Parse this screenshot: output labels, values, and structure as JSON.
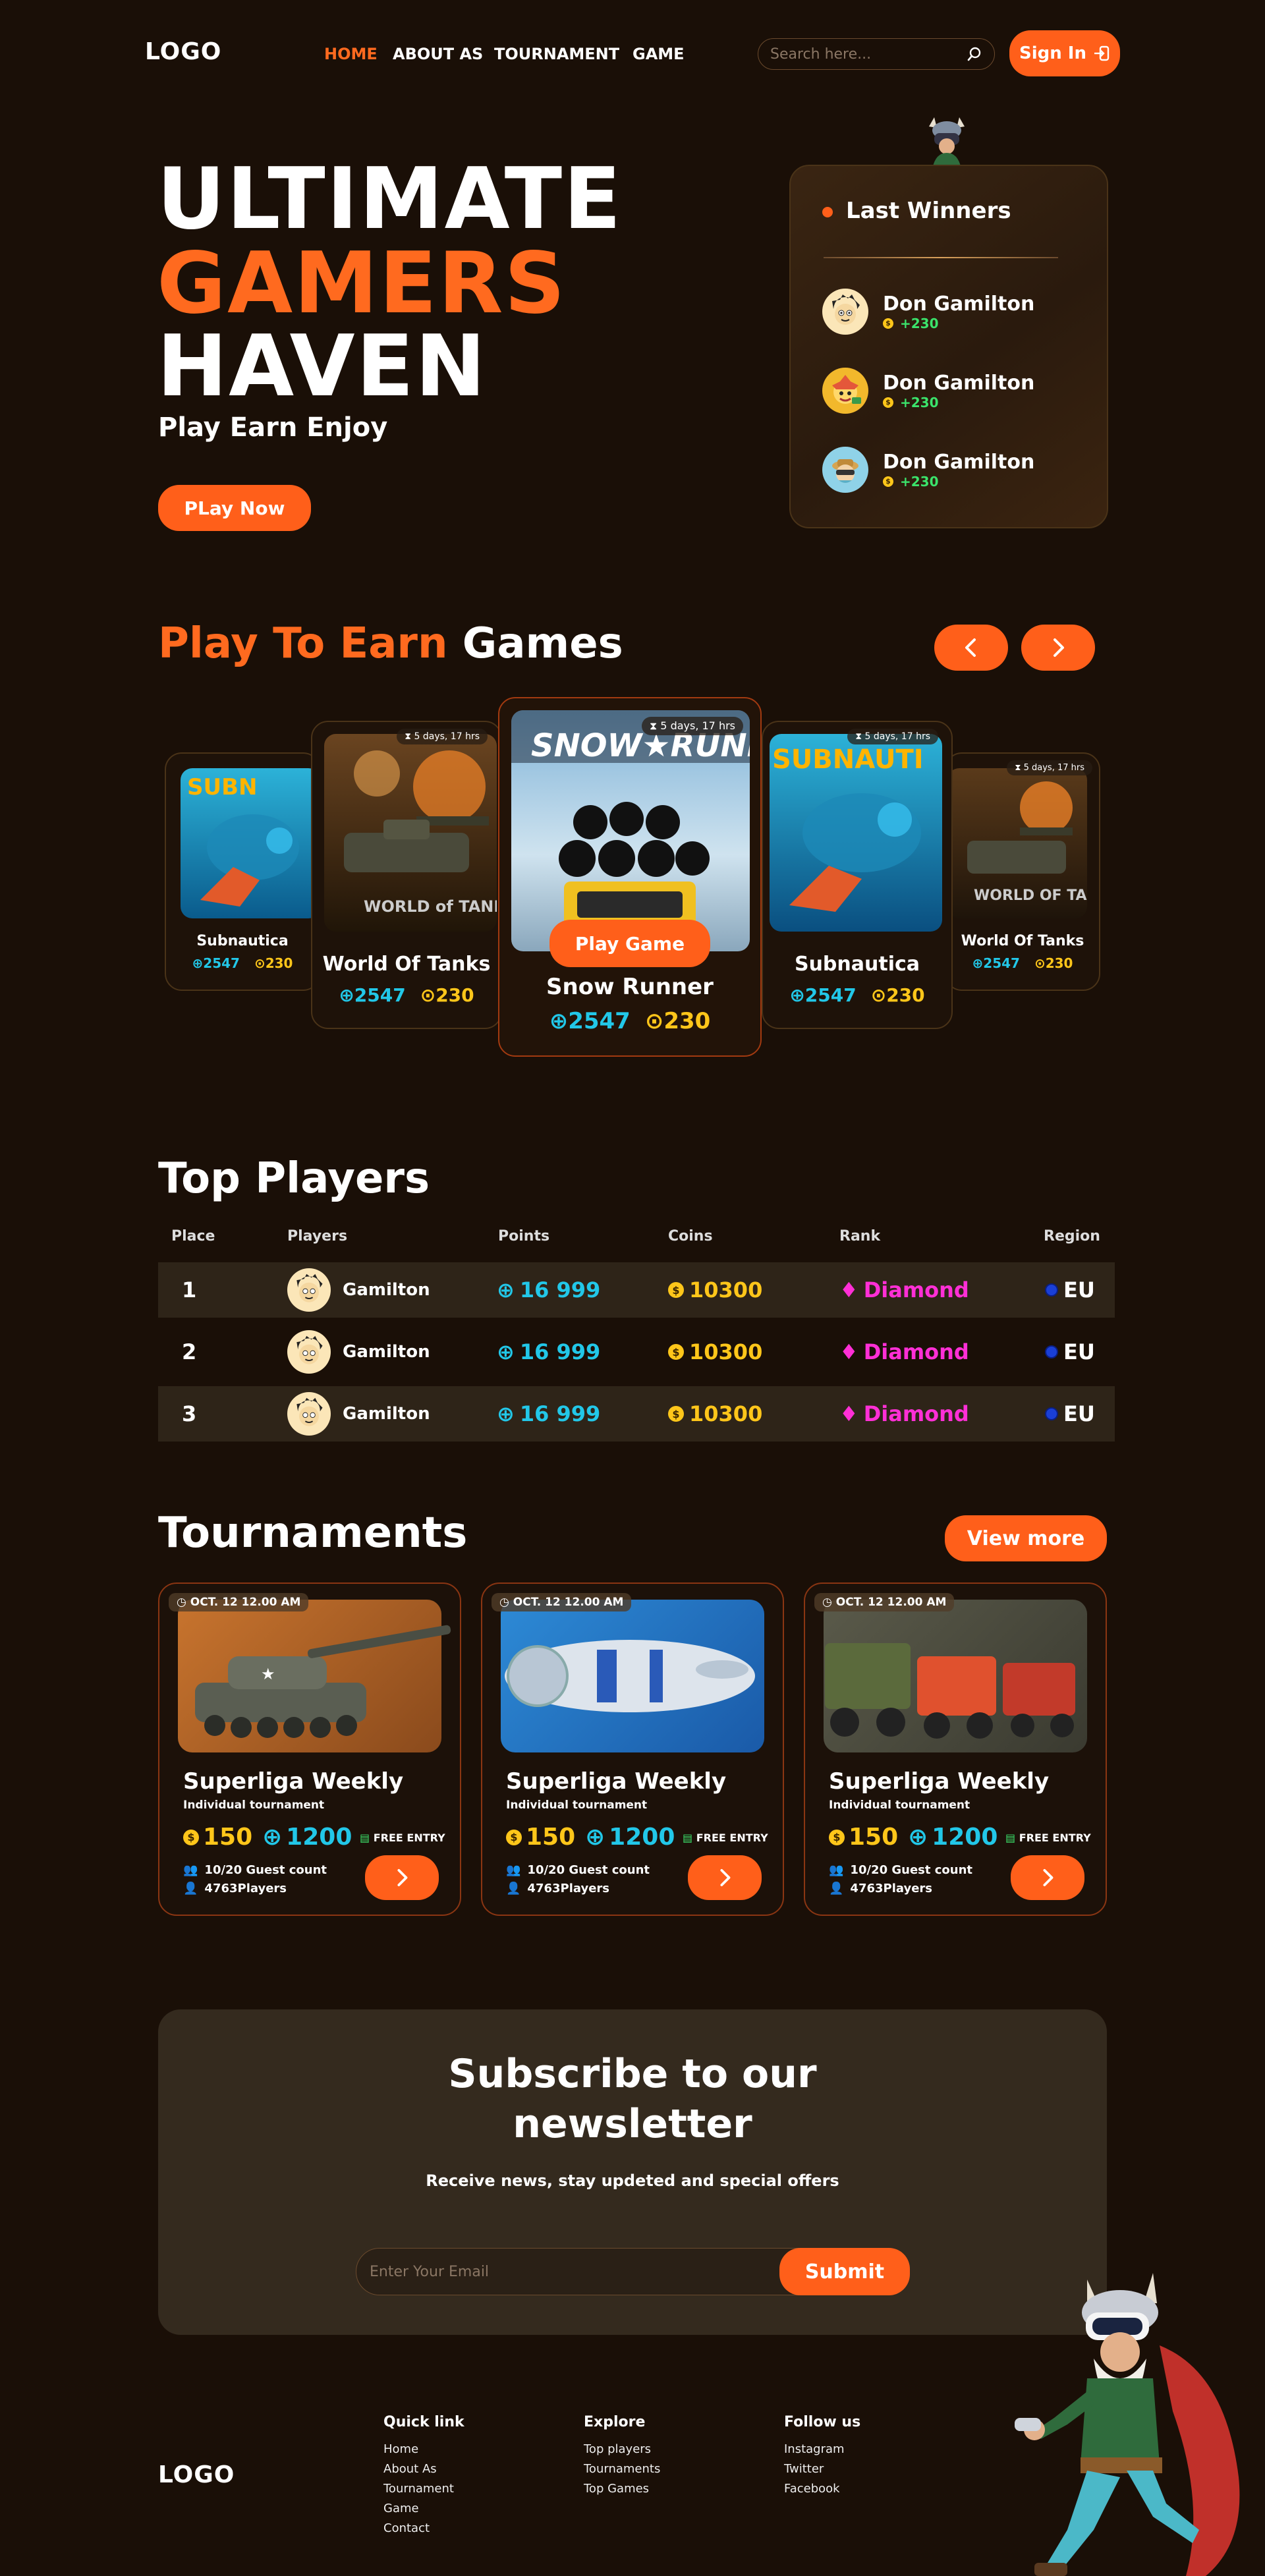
{
  "nav": {
    "logo": "LOGO",
    "links": [
      "HOME",
      "ABOUT AS",
      "TOURNAMENT",
      "GAME"
    ],
    "search_placeholder": "Search here...",
    "signin_label": "Sign In"
  },
  "hero": {
    "line1": "ULTIMATE",
    "line2": "GAMERS",
    "line3": "HAVEN",
    "tagline": "Play Earn Enjoy",
    "cta": "PLay Now"
  },
  "winners": {
    "title": "Last Winners",
    "items": [
      {
        "name": "Don Gamilton",
        "points": "+230"
      },
      {
        "name": "Don Gamilton",
        "points": "+230"
      },
      {
        "name": "Don Gamilton",
        "points": "+230"
      }
    ]
  },
  "games_section": {
    "title_highlight": "Play To Earn",
    "title_rest": "Games",
    "play_label": "Play Game",
    "timer": "5 days, 17 hrs",
    "cards": [
      {
        "title": "Subnautica",
        "points": "2547",
        "coins": "230"
      },
      {
        "title": "World Of Tanks",
        "points": "2547",
        "coins": "230"
      },
      {
        "title": "Snow Runner",
        "points": "2547",
        "coins": "230"
      },
      {
        "title": "Subnautica",
        "points": "2547",
        "coins": "230"
      },
      {
        "title": "World Of Tanks",
        "points": "2547",
        "coins": "230"
      }
    ]
  },
  "top_players": {
    "title": "Top Players",
    "headers": [
      "Place",
      "Players",
      "Points",
      "Coins",
      "Rank",
      "Region"
    ],
    "rows": [
      {
        "place": "1",
        "player": "Gamilton",
        "points": "16 999",
        "coins": "10300",
        "rank": "Diamond",
        "region": "EU"
      },
      {
        "place": "2",
        "player": "Gamilton",
        "points": "16 999",
        "coins": "10300",
        "rank": "Diamond",
        "region": "EU"
      },
      {
        "place": "3",
        "player": "Gamilton",
        "points": "16 999",
        "coins": "10300",
        "rank": "Diamond",
        "region": "EU"
      }
    ]
  },
  "tournaments": {
    "title": "Tournaments",
    "view_more": "View more",
    "cards": [
      {
        "date": "OCT. 12   12.00 AM",
        "title": "Superliga Weekly",
        "subtitle": "Individual tournament",
        "coins": "150",
        "points": "1200",
        "entry": "FREE ENTRY",
        "guests": "10/20 Guest count",
        "players": "4763Players"
      },
      {
        "date": "OCT. 12   12.00 AM",
        "title": "Superliga Weekly",
        "subtitle": "Individual tournament",
        "coins": "150",
        "points": "1200",
        "entry": "FREE ENTRY",
        "guests": "10/20 Guest count",
        "players": "4763Players"
      },
      {
        "date": "OCT. 12   12.00 AM",
        "title": "Superliga Weekly",
        "subtitle": "Individual tournament",
        "coins": "150",
        "points": "1200",
        "entry": "FREE ENTRY",
        "guests": "10/20 Guest count",
        "players": "4763Players"
      }
    ]
  },
  "newsletter": {
    "title_line1": "Subscribe to our",
    "title_line2": "newsletter",
    "subtitle": "Receive news, stay updeted and special offers",
    "email_placeholder": "Enter Your Email",
    "submit_label": "Submit"
  },
  "footer": {
    "logo": "LOGO",
    "columns": [
      {
        "title": "Quick link",
        "links": [
          "Home",
          "About As",
          "Tournament",
          "Game",
          "Contact"
        ]
      },
      {
        "title": "Explore",
        "links": [
          "Top players",
          "Tournaments",
          "Top Games"
        ]
      },
      {
        "title": "Follow us",
        "links": [
          "Instagram",
          "Twitter",
          "Facebook"
        ]
      }
    ]
  },
  "colors": {
    "accent": "#ff5f1a",
    "background": "#1a0f07",
    "points": "#22c7e8",
    "coins": "#ffc61a",
    "rank": "#ff2fd6",
    "win": "#3be36b"
  }
}
